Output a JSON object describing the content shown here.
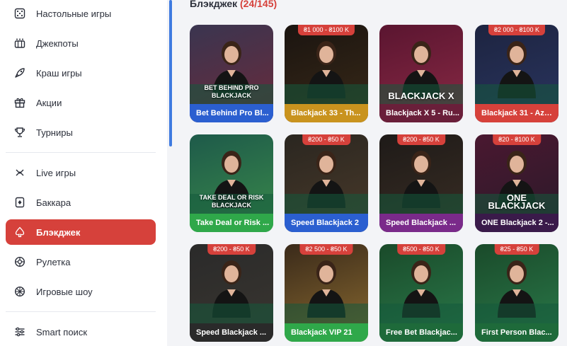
{
  "sidebar": {
    "items": [
      {
        "label": "Настольные игры",
        "icon": "dice-icon"
      },
      {
        "label": "Джекпоты",
        "icon": "jackpot-icon"
      },
      {
        "label": "Краш игры",
        "icon": "rocket-icon"
      },
      {
        "label": "Акции",
        "icon": "gift-icon"
      },
      {
        "label": "Турниры",
        "icon": "trophy-icon"
      },
      {
        "label": "Live игры",
        "icon": "live-icon"
      },
      {
        "label": "Баккара",
        "icon": "card-icon"
      },
      {
        "label": "Блэкджек",
        "icon": "spade-icon",
        "active": true
      },
      {
        "label": "Рулетка",
        "icon": "roulette-icon"
      },
      {
        "label": "Игровые шоу",
        "icon": "wheel-icon"
      },
      {
        "label": "Smart поиск",
        "icon": "filter-icon"
      }
    ]
  },
  "main": {
    "title": "Блэкджек",
    "count": "(24/145)"
  },
  "games": [
    {
      "name": "Bet Behind Pro Bl...",
      "limit": "",
      "bar": "#2b5fd0",
      "bg": [
        "#3a3550",
        "#6b2a3a"
      ],
      "logo": "BET BEHIND PRO BLACKJACK"
    },
    {
      "name": "Blackjack 33 - Th...",
      "limit": "₴1 000 - ₴100 K",
      "bar": "#c9931e",
      "bg": [
        "#1a1410",
        "#3a2a18"
      ],
      "logo": ""
    },
    {
      "name": "Blackjack X 5 - Ru...",
      "limit": "",
      "bar": "#6a1f3a",
      "bg": [
        "#5a1530",
        "#8a2a45"
      ],
      "logo": "BLACKJACK X"
    },
    {
      "name": "Blackjack 31 - Azu...",
      "limit": "₴2 000 - ₴100 K",
      "bar": "#d6413b",
      "bg": [
        "#1d2440",
        "#2a3560"
      ],
      "logo": ""
    },
    {
      "name": "Take Deal or Risk ...",
      "limit": "",
      "bar": "#2fa84a",
      "bg": [
        "#1e5a4a",
        "#3a8a4a"
      ],
      "logo": "TAKE DEAL OR RISK BLACKJACK"
    },
    {
      "name": "Speed Blackjack 2",
      "limit": "₴200 - ₴50 K",
      "bar": "#2b5fd0",
      "bg": [
        "#2a2620",
        "#4a3a2a"
      ],
      "logo": ""
    },
    {
      "name": "Speed Blackjack ...",
      "limit": "₴200 - ₴50 K",
      "bar": "#7a2a8a",
      "bg": [
        "#1e1a18",
        "#3a2e24"
      ],
      "logo": ""
    },
    {
      "name": "ONE Blackjack 2 -...",
      "limit": "₴20 - ₴100 K",
      "bar": "#3a1a4a",
      "bg": [
        "#4a1830",
        "#2a1a2a"
      ],
      "logo": "ONE BLACKJACK"
    },
    {
      "name": "Speed Blackjack ...",
      "limit": "₴200 - ₴50 K",
      "bar": "#2a2a2a",
      "bg": [
        "#2a2a2a",
        "#3a3630"
      ],
      "logo": ""
    },
    {
      "name": "Blackjack VIP 21",
      "limit": "₴2 500 - ₴50 K",
      "bar": "#2fa84a",
      "bg": [
        "#3a2a1a",
        "#8a6a30"
      ],
      "logo": ""
    },
    {
      "name": "Free Bet Blackjac...",
      "limit": "₴500 - ₴50 K",
      "bar": "#1e6a3a",
      "bg": [
        "#1a4a2a",
        "#2a7a4a"
      ],
      "logo": ""
    },
    {
      "name": "First Person Blac...",
      "limit": "₴25 - ₴50 K",
      "bar": "#1e6a3a",
      "bg": [
        "#1a4a2a",
        "#2a7a4a"
      ],
      "logo": ""
    }
  ]
}
